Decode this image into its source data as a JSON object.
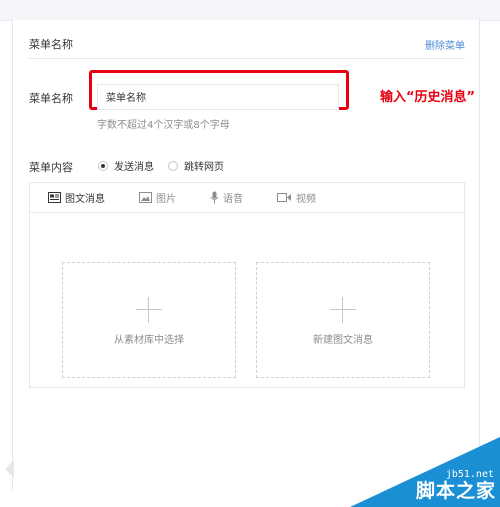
{
  "panel": {
    "title": "菜单名称",
    "delete_label": "删除菜单"
  },
  "form": {
    "name_label": "菜单名称",
    "name_value": "菜单名称",
    "hint": "字数不超过4个汉字或8个字母",
    "content_label": "菜单内容",
    "options": [
      {
        "label": "发送消息",
        "selected": true
      },
      {
        "label": "跳转网页",
        "selected": false
      }
    ]
  },
  "annotation": {
    "text": "输入“历史消息”",
    "color": "#e60012"
  },
  "editor": {
    "tabs": [
      {
        "label": "图文消息",
        "icon": "news-icon",
        "active": true
      },
      {
        "label": "图片",
        "icon": "image-icon",
        "active": false
      },
      {
        "label": "语音",
        "icon": "microphone-icon",
        "active": false
      },
      {
        "label": "视频",
        "icon": "video-icon",
        "active": false
      }
    ],
    "cards": [
      {
        "label": "从素材库中选择"
      },
      {
        "label": "新建图文消息"
      }
    ]
  },
  "watermark": {
    "site": "jb51.net",
    "text": "脚本之家"
  },
  "colors": {
    "link": "#4a8bd6",
    "highlight": "#e60012",
    "watermark": "#1a8fd4"
  }
}
